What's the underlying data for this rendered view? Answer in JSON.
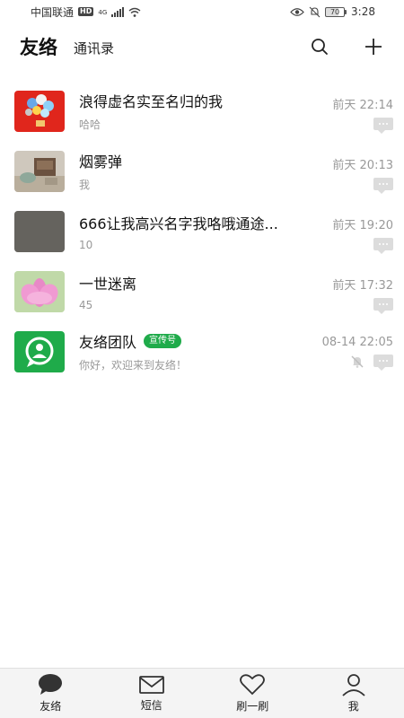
{
  "status_bar": {
    "carrier": "中国联通",
    "hd": "HD",
    "network": "4G",
    "battery": "70",
    "time": "3:28",
    "icons": [
      "signal-icon",
      "wifi-icon",
      "eye-icon",
      "mute-icon",
      "battery-icon"
    ]
  },
  "header": {
    "title": "友络",
    "tab": "通讯录",
    "icons": [
      "search-icon",
      "plus-icon"
    ]
  },
  "conversations": [
    {
      "name": "浪得虚名实至名归的我",
      "preview": "哈哈",
      "time": "前天 22:14",
      "avatar": "balloons",
      "muted": false
    },
    {
      "name": "烟雾弹",
      "preview": "我",
      "time": "前天 20:13",
      "avatar": "room",
      "muted": false
    },
    {
      "name": "666让我高兴名字我咯哦通途...",
      "preview": "10",
      "time": "前天 19:20",
      "avatar": "gray",
      "muted": false
    },
    {
      "name": "一世迷离",
      "preview": "45",
      "time": "前天 17:32",
      "avatar": "lotus",
      "muted": false
    },
    {
      "name": "友络团队",
      "badge": "宣传号",
      "preview": "你好，欢迎来到友络！",
      "time": "08-14 22:05",
      "avatar": "app-logo",
      "muted": true
    }
  ],
  "tabs": [
    {
      "label": "友络",
      "icon": "chat-icon"
    },
    {
      "label": "短信",
      "icon": "mail-icon"
    },
    {
      "label": "刷一刷",
      "icon": "heart-icon"
    },
    {
      "label": "我",
      "icon": "person-icon"
    }
  ],
  "colors": {
    "accent": "#1fab4a",
    "badge": "#1fab4a",
    "meta_text": "#999999"
  }
}
